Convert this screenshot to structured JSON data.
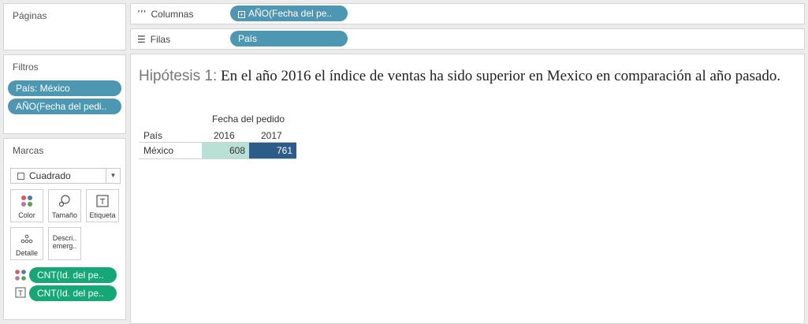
{
  "left": {
    "paginas_title": "Páginas",
    "filtros_title": "Filtros",
    "filters": [
      "País: México",
      "AÑO(Fecha del pedi.."
    ],
    "marcas_title": "Marcas",
    "mark_type": "Cuadrado",
    "mark_buttons": {
      "color": "Color",
      "tamano": "Tamaño",
      "etiqueta": "Etiqueta",
      "detalle": "Detalle",
      "descr_line1": "Descri..",
      "descr_line2": "emerg.."
    },
    "mark_fields": [
      "CNT(Id. del pe..",
      "CNT(Id. del pe.."
    ]
  },
  "shelves": {
    "columns_label": "Columnas",
    "columns_pill": "AÑO(Fecha del pe..",
    "rows_label": "Filas",
    "rows_pill": "País"
  },
  "viz": {
    "title_prefix": "Hipótesis 1:",
    "title_text": " En el año 2016 el índice de ventas ha sido superior en Mexico en comparación al año pasado.",
    "col_group_header": "Fecha del pedido",
    "row_header": "País",
    "years": [
      "2016",
      "2017"
    ],
    "row_label": "México",
    "values": [
      "608",
      "761"
    ],
    "cell_colors": [
      "#b8e0d4",
      "#2b5c8a"
    ]
  },
  "colors": {
    "pill_blue": "#4e97b3",
    "pill_green": "#15a876"
  }
}
